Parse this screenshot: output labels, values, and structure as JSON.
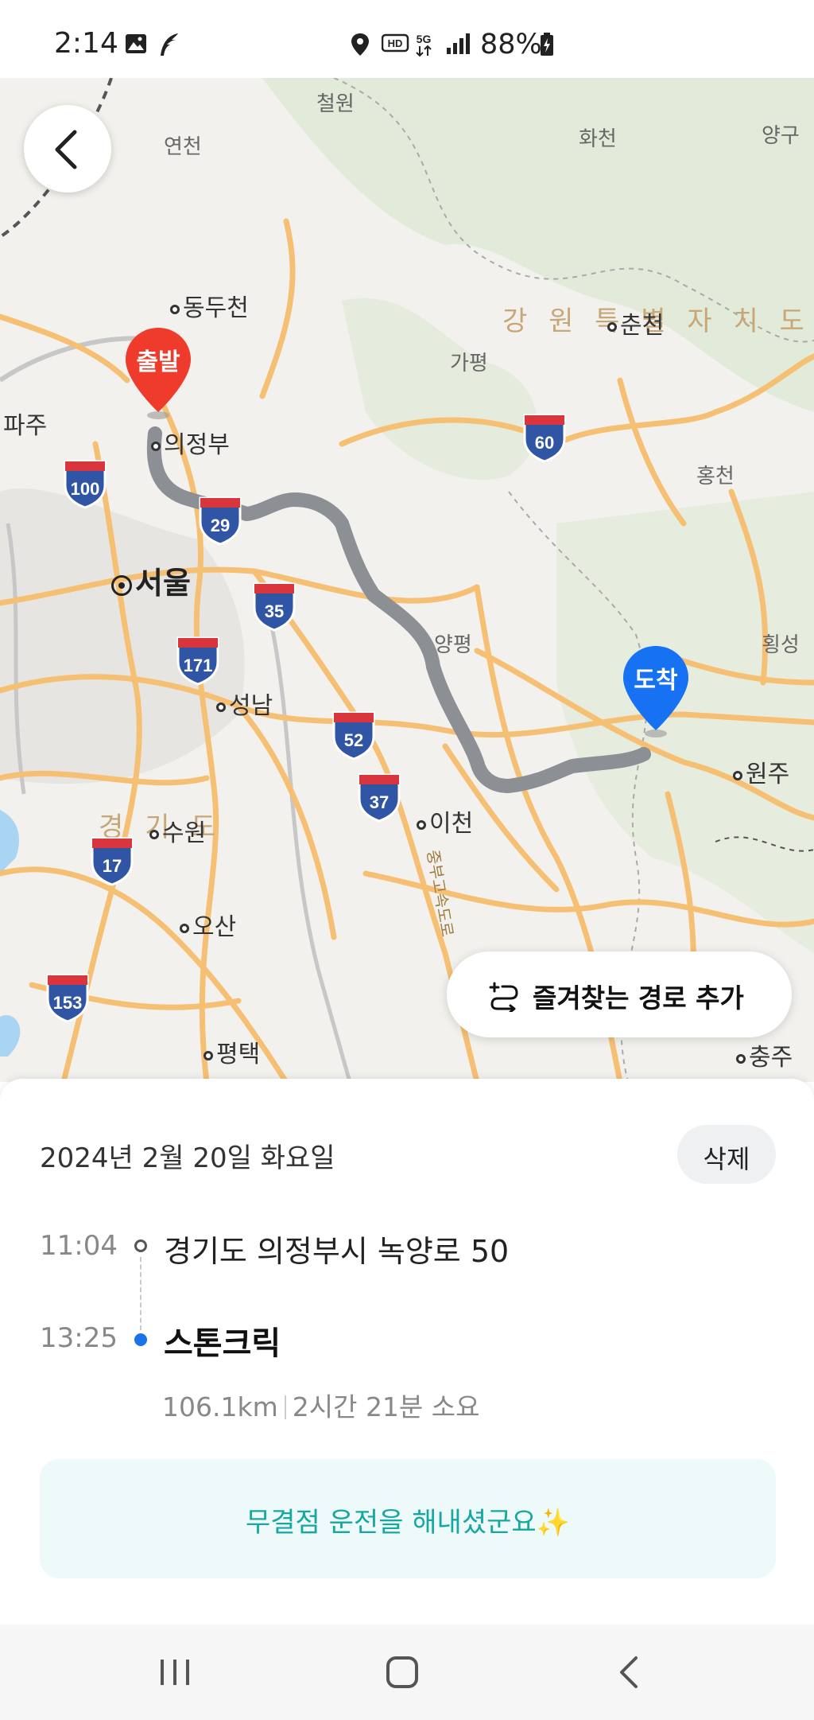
{
  "status_bar": {
    "time": "2:14",
    "battery": "88%",
    "icons": [
      "gallery-icon",
      "feather-icon",
      "location-icon",
      "hd-icon",
      "5g-icon",
      "signal-icon",
      "battery-icon"
    ]
  },
  "map": {
    "labels": {
      "cheorwon": "철원",
      "yeoncheon": "연천",
      "hwacheon": "화천",
      "yanggu": "양구",
      "dongducheon": "동두천",
      "gangwon": "강 원 특 별 자 치 도",
      "chuncheon": "춘천",
      "gapyeong": "가평",
      "paju": "파주",
      "uijeongbu": "의정부",
      "hongcheon": "홍천",
      "seoul": "서울",
      "yangpyeong": "양평",
      "hoengseong": "횡성",
      "seongnam": "성남",
      "wonju": "원주",
      "gyeonggi": "경 기 도",
      "suwon": "수원",
      "icheon": "이천",
      "osan": "오산",
      "pyeongtaek": "평택",
      "chungju": "충주",
      "jungbu_expressway": "중부고속도로"
    },
    "shields": [
      "100",
      "29",
      "60",
      "35",
      "171",
      "52",
      "37",
      "17",
      "153"
    ],
    "start_pin": "출발",
    "end_pin": "도착",
    "route_color": "#8c8f94",
    "start_color": "#ee3b2b",
    "end_color": "#1672f3"
  },
  "favorite_route_button": "즐겨찾는 경로 추가",
  "trip": {
    "date": "2024년 2월 20일 화요일",
    "delete_label": "삭제",
    "start_time": "11:04",
    "start_address": "경기도 의정부시 녹양로 50",
    "end_time": "13:25",
    "destination": "스톤크릭",
    "distance": "106.1km",
    "duration": "2시간 21분 소요",
    "message": "무결점 운전을 해내셨군요✨"
  },
  "nav_bar": {
    "buttons": [
      "recent-apps-icon",
      "home-icon",
      "back-icon"
    ]
  }
}
